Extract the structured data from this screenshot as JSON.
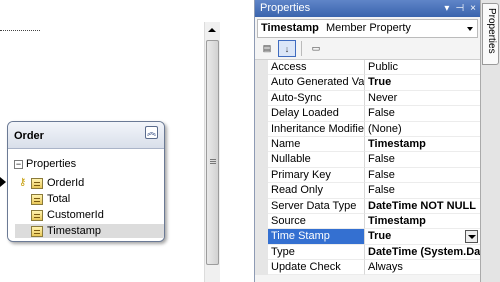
{
  "designer": {
    "entity": {
      "title": "Order",
      "section": "Properties",
      "items": [
        "OrderId",
        "Total",
        "CustomerId",
        "Timestamp"
      ]
    }
  },
  "properties": {
    "window_title": "Properties",
    "title_buttons": [
      "▾",
      "⊣",
      "×"
    ],
    "object_name": "Timestamp",
    "object_type": "Member Property",
    "grid": [
      {
        "name": "Access",
        "value": "Public",
        "bold": false
      },
      {
        "name": "Auto Generated Value",
        "value": "True",
        "bold": true
      },
      {
        "name": "Auto-Sync",
        "value": "Never",
        "bold": false
      },
      {
        "name": "Delay Loaded",
        "value": "False",
        "bold": false
      },
      {
        "name": "Inheritance Modifier",
        "value": "(None)",
        "bold": false
      },
      {
        "name": "Name",
        "value": "Timestamp",
        "bold": true
      },
      {
        "name": "Nullable",
        "value": "False",
        "bold": false
      },
      {
        "name": "Primary Key",
        "value": "False",
        "bold": false
      },
      {
        "name": "Read Only",
        "value": "False",
        "bold": false
      },
      {
        "name": "Server Data Type",
        "value": "DateTime NOT NULL",
        "bold": true
      },
      {
        "name": "Source",
        "value": "Timestamp",
        "bold": true
      },
      {
        "name": "Time Stamp",
        "value": "True",
        "bold": true,
        "selected": true
      },
      {
        "name": "Type",
        "value": "DateTime (System.DateTi",
        "bold": true
      },
      {
        "name": "Update Check",
        "value": "Always",
        "bold": false
      }
    ]
  },
  "side_tab": {
    "label": "Properties"
  }
}
